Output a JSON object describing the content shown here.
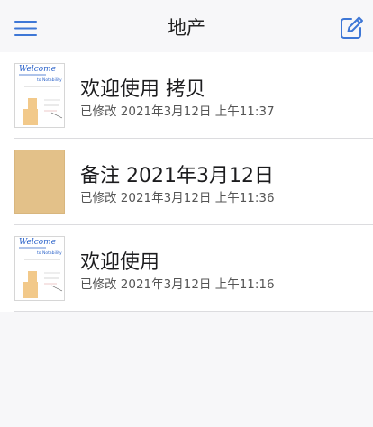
{
  "nav": {
    "title": "地产",
    "menu_icon": "hamburger-menu-icon",
    "compose_icon": "compose-icon",
    "accent_color": "#3e77d6"
  },
  "documents": [
    {
      "title": "欢迎使用 拷贝",
      "meta": "已修改 2021年3月12日 上午11:37",
      "thumbnail": "welcome-notebook-thumbnail",
      "thumb_text": "Welcome"
    },
    {
      "title": "备注 2021年3月12日",
      "meta": "已修改 2021年3月12日 上午11:36",
      "thumbnail": "kraft-paper-thumbnail",
      "thumb_text": ""
    },
    {
      "title": "欢迎使用",
      "meta": "已修改 2021年3月12日 上午11:16",
      "thumbnail": "welcome-notebook-thumbnail",
      "thumb_text": "Welcome"
    }
  ]
}
